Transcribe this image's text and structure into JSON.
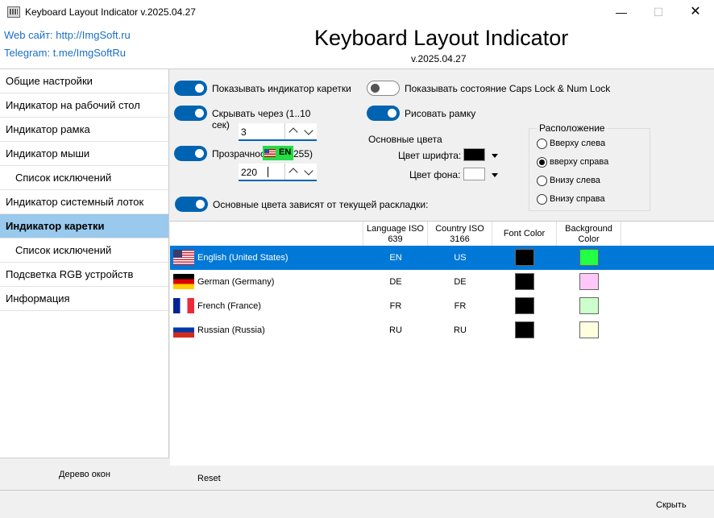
{
  "window": {
    "title": "Keyboard Layout Indicator v.2025.04.27",
    "minimize_glyph": "—",
    "maximize_glyph": "☐",
    "close_glyph": "✕"
  },
  "header": {
    "web": "Web сайт: http://ImgSoft.ru",
    "telegram": "Telegram: t.me/ImgSoftRu",
    "app_title": "Keyboard Layout Indicator",
    "version": "v.2025.04.27"
  },
  "sidebar": {
    "items": [
      {
        "label": "Общие настройки"
      },
      {
        "label": "Индикатор на рабочий стол"
      },
      {
        "label": "Индикатор рамка"
      },
      {
        "label": "Индикатор мыши"
      },
      {
        "label": "Список исключений"
      },
      {
        "label": "Индикатор системный лоток"
      },
      {
        "label": "Индикатор каретки"
      },
      {
        "label": "Список исключений"
      },
      {
        "label": "Подсветка RGB устройств"
      },
      {
        "label": "Информация"
      }
    ],
    "active_index": 6,
    "tree_button": "Дерево окон"
  },
  "settings": {
    "show_caret_indicator": {
      "label": "Показывать индикатор каретки",
      "on": true
    },
    "hide_after": {
      "label_line1": "Скрывать через (1..10",
      "label_line2": "сек)",
      "on": true,
      "value": "3"
    },
    "transparency": {
      "label_left": "Прозрачност",
      "label_right": "255)",
      "on": true,
      "value": "220"
    },
    "caps_num": {
      "label": "Показывать состояние Caps Lock & Num Lock",
      "on": false
    },
    "draw_frame": {
      "label": "Рисовать рамку",
      "on": true
    },
    "main_colors": {
      "title": "Основные цвета",
      "font_label": "Цвет шрифта:",
      "bg_label": "Цвет фона:",
      "font_color": "#000000",
      "bg_color": "#ffffff"
    },
    "colors_depend": {
      "label": "Основные цвета зависят от текущей раскладки:",
      "on": true
    },
    "indicator_preview": {
      "text": "EN",
      "color": "#22dd44"
    },
    "position": {
      "legend": "Расположение",
      "options": [
        "Вверху слева",
        "вверху справа",
        "Внизу слева",
        "Внизу справа"
      ],
      "selected": 1
    }
  },
  "table": {
    "headers": [
      "",
      "Language ISO 639",
      "Country ISO 3166",
      "Font Color",
      "Background Color"
    ],
    "rows": [
      {
        "flag": "us-flag",
        "name": "English (United States)",
        "lang": "EN",
        "country": "US",
        "font_color": "#000000",
        "bg_color": "#22ff44",
        "selected": true
      },
      {
        "flag": "de-flag",
        "name": "German (Germany)",
        "lang": "DE",
        "country": "DE",
        "font_color": "#000000",
        "bg_color": "#ffc8f8",
        "selected": false
      },
      {
        "flag": "fr-flag",
        "name": "French (France)",
        "lang": "FR",
        "country": "FR",
        "font_color": "#000000",
        "bg_color": "#ccffcc",
        "selected": false
      },
      {
        "flag": "ru-flag",
        "name": "Russian (Russia)",
        "lang": "RU",
        "country": "RU",
        "font_color": "#000000",
        "bg_color": "#ffffe0",
        "selected": false
      }
    ],
    "reset": "Reset"
  },
  "footer": {
    "hide_button": "Скрыть"
  },
  "colors": {
    "accent": "#0063b1",
    "selection": "#0078d7",
    "active_nav": "#99c9ec",
    "link": "#1a6fc4"
  }
}
